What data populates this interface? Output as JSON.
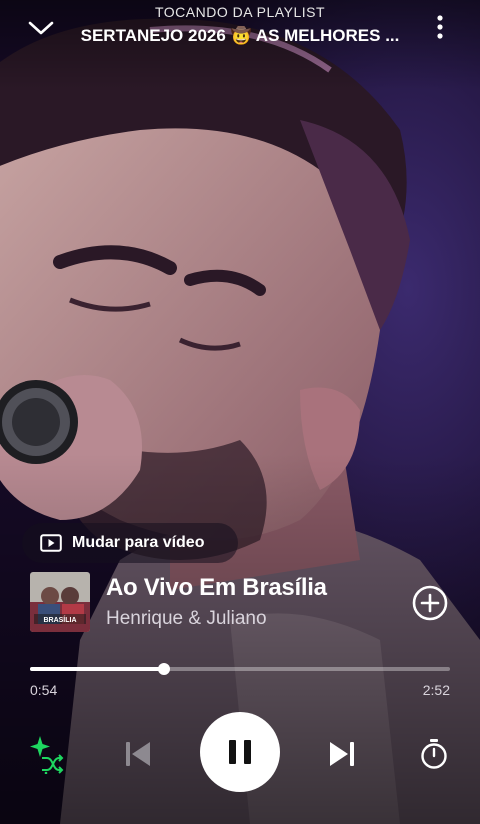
{
  "header": {
    "context_label": "TOCANDO DA PLAYLIST",
    "playlist_name": "SERTANEJO 2026 🤠 AS MELHORES ..."
  },
  "video_toggle": {
    "label": "Mudar para vídeo"
  },
  "track": {
    "title": "Ao Vivo Em Brasília",
    "artist": "Henrique & Juliano",
    "cover_text": "BRASÍLIA"
  },
  "playback": {
    "elapsed": "0:54",
    "duration": "2:52",
    "progress_fraction": 0.32,
    "state": "playing"
  },
  "colors": {
    "accent_green": "#1ed760",
    "background": "#1a0f2a",
    "text_primary": "#ffffff",
    "text_secondary": "#d9d4dc"
  },
  "icons": {
    "collapse": "chevron-down-icon",
    "more": "vertical-dots-icon",
    "video": "play-square-icon",
    "add": "plus-circle-icon",
    "smart_shuffle": "smart-shuffle-icon",
    "previous": "skip-previous-icon",
    "pause": "pause-icon",
    "next": "skip-next-icon",
    "timer": "sleep-timer-icon"
  }
}
